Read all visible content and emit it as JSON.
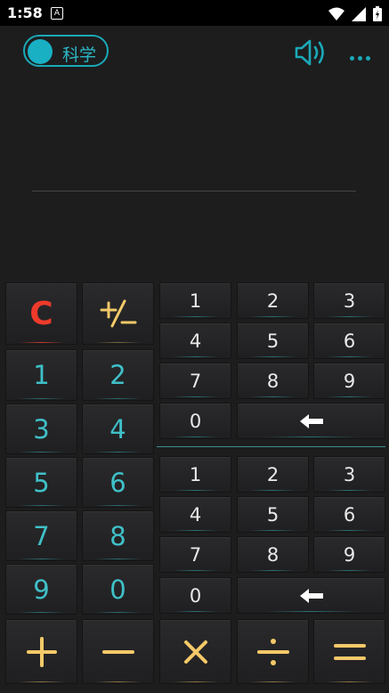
{
  "status_bar": {
    "time": "1:58",
    "notification_icon_letter": "A",
    "icons": [
      "wifi-icon",
      "signal-icon",
      "battery-icon"
    ]
  },
  "top_bar": {
    "mode_label": "科学",
    "speaker_icon": "speaker-icon",
    "more_icon": "more-icon"
  },
  "display": {
    "expression": "",
    "result": ""
  },
  "left_pad": {
    "clear_label": "C",
    "sign_label": "+/−",
    "digits": [
      "1",
      "2",
      "3",
      "4",
      "5",
      "6",
      "7",
      "8",
      "9",
      "0"
    ]
  },
  "right_pad_top": {
    "digits": [
      "1",
      "2",
      "3",
      "4",
      "5",
      "6",
      "7",
      "8",
      "9",
      "0"
    ],
    "backspace_label": "←"
  },
  "right_pad_bottom": {
    "digits": [
      "1",
      "2",
      "3",
      "4",
      "5",
      "6",
      "7",
      "8",
      "9",
      "0"
    ],
    "backspace_label": "←"
  },
  "operators": [
    "+",
    "−",
    "×",
    "÷",
    "="
  ],
  "colors": {
    "accent": "#1aa9b8",
    "digit_teal": "#3fc0c8",
    "clear_red": "#ee3a2b",
    "operator_gold": "#f3c969",
    "background": "#1d1d1e"
  }
}
